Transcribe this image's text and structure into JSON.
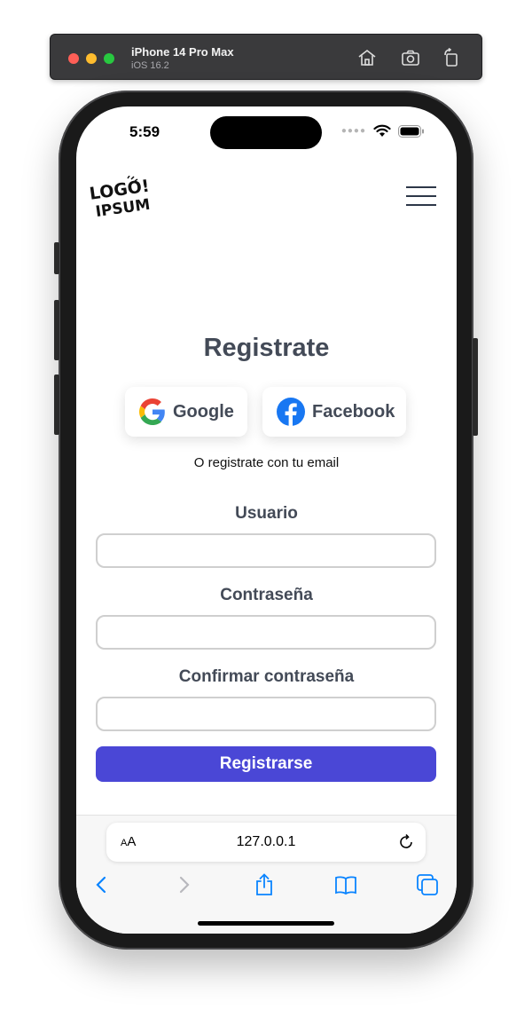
{
  "simulator": {
    "device_name": "iPhone 14 Pro Max",
    "os_version": "iOS 16.2",
    "icons": [
      "home-icon",
      "screenshot-icon",
      "rotate-icon"
    ]
  },
  "status_bar": {
    "time": "5:59",
    "icons": [
      "cellular-icon",
      "wifi-icon",
      "battery-icon"
    ]
  },
  "header": {
    "logo_line1": "LOGO!",
    "logo_line2": "IPSUM",
    "menu_icon": "hamburger-menu-icon"
  },
  "register": {
    "title": "Registrate",
    "google_label": "Google",
    "facebook_label": "Facebook",
    "or_text": "O registrate con tu email",
    "fields": [
      {
        "label": "Usuario",
        "value": ""
      },
      {
        "label": "Contraseña",
        "value": ""
      },
      {
        "label": "Confirmar contraseña",
        "value": ""
      }
    ],
    "submit_label": "Registrarse"
  },
  "browser": {
    "text_size_label_small": "A",
    "text_size_label_large": "A",
    "url": "127.0.0.1",
    "toolbar_icons": [
      "back-icon",
      "forward-icon",
      "share-icon",
      "bookmarks-icon",
      "tabs-icon"
    ]
  },
  "colors": {
    "primary": "#4a47d6",
    "heading": "#434a57",
    "ios_blue": "#0a84ff"
  }
}
